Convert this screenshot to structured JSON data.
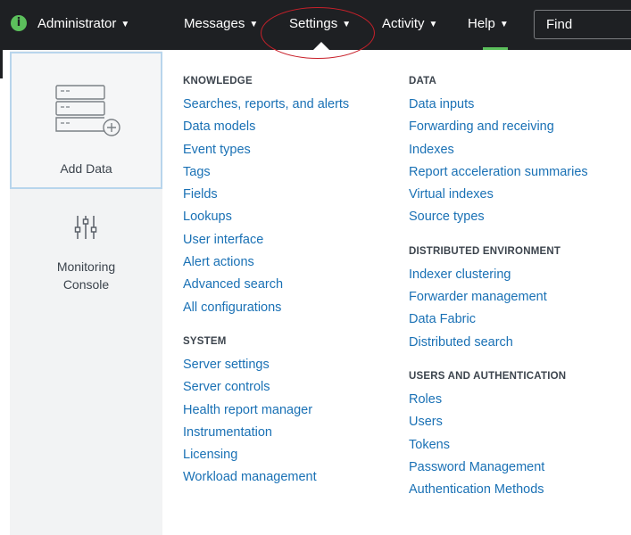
{
  "topbar": {
    "items": [
      {
        "label": "Administrator"
      },
      {
        "label": "Messages"
      },
      {
        "label": "Settings"
      },
      {
        "label": "Activity"
      },
      {
        "label": "Help"
      }
    ],
    "search_placeholder": "Find",
    "info_icon": "info-icon",
    "colors": {
      "bar": "#1e2023",
      "highlight_oval": "#c8202a",
      "accent": "#5cc05c"
    }
  },
  "sidebar": {
    "add_data_label": "Add Data",
    "add_data_icon": "server-add-icon",
    "monitoring_label_line1": "Monitoring",
    "monitoring_label_line2": "Console",
    "monitoring_icon": "sliders-icon"
  },
  "menu": {
    "knowledge": {
      "title": "KNOWLEDGE",
      "links": [
        "Searches, reports, and alerts",
        "Data models",
        "Event types",
        "Tags",
        "Fields",
        "Lookups",
        "User interface",
        "Alert actions",
        "Advanced search",
        "All configurations"
      ]
    },
    "system": {
      "title": "SYSTEM",
      "links": [
        "Server settings",
        "Server controls",
        "Health report manager",
        "Instrumentation",
        "Licensing",
        "Workload management"
      ]
    },
    "data": {
      "title": "DATA",
      "links": [
        "Data inputs",
        "Forwarding and receiving",
        "Indexes",
        "Report acceleration summaries",
        "Virtual indexes",
        "Source types"
      ]
    },
    "distributed": {
      "title": "DISTRIBUTED ENVIRONMENT",
      "links": [
        "Indexer clustering",
        "Forwarder management",
        "Data Fabric",
        "Distributed search"
      ]
    },
    "users": {
      "title": "USERS AND AUTHENTICATION",
      "links": [
        "Roles",
        "Users",
        "Tokens",
        "Password Management",
        "Authentication Methods"
      ]
    },
    "link_color": "#1a71b5"
  }
}
